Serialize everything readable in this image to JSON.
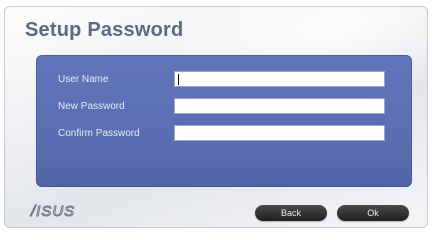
{
  "dialog": {
    "title": "Setup Password"
  },
  "form": {
    "user_name_label": "User Name",
    "user_name_value": "",
    "new_password_label": "New Password",
    "new_password_value": "",
    "confirm_password_label": "Confirm Password",
    "confirm_password_value": ""
  },
  "footer": {
    "logo_text": "/ISUS",
    "back_label": "Back",
    "ok_label": "Ok"
  },
  "colors": {
    "panel_blue": "#5a6fb3",
    "title_color": "#5a6a88",
    "button_dark": "#2a2a2a"
  },
  "icons": {
    "logo": "asus-logo"
  }
}
